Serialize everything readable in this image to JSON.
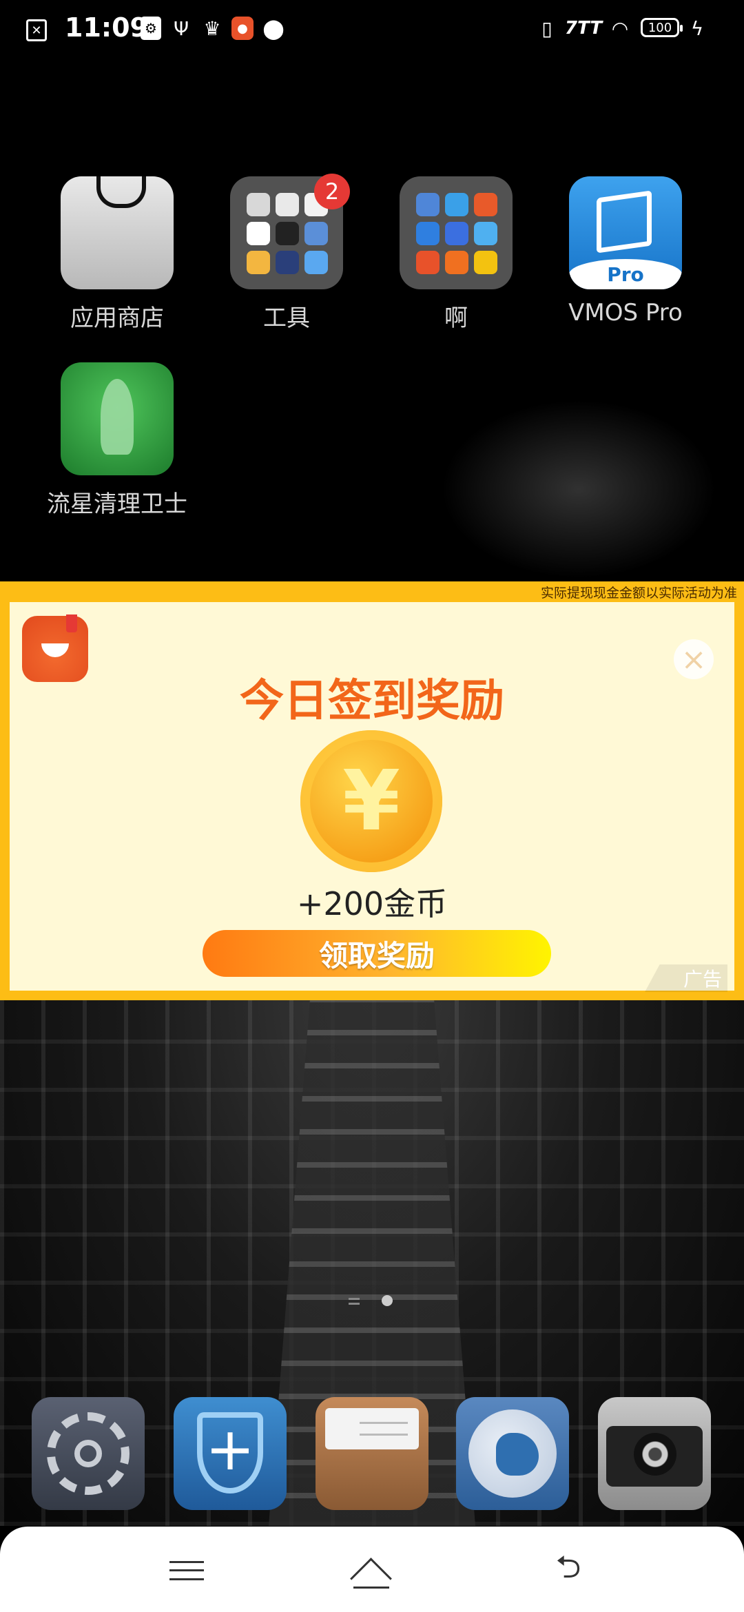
{
  "status_bar": {
    "time": "11:09",
    "battery": "100",
    "icons": [
      "sim-off-icon",
      "usb-debug-icon",
      "usb-icon",
      "crown-icon",
      "tomato-app-icon",
      "location-du-icon",
      "vibrate-icon",
      "signal-icon",
      "wifi-icon",
      "battery-icon",
      "charging-icon"
    ]
  },
  "apps": [
    {
      "label": "应用商店",
      "icon": "app-store-bag-icon"
    },
    {
      "label": "工具",
      "icon": "folder-icon",
      "badge": "2"
    },
    {
      "label": "啊",
      "icon": "folder-icon"
    },
    {
      "label": "VMOS Pro",
      "icon": "vmos-pro-icon",
      "badge_text": "Pro"
    },
    {
      "label": "流星清理卫士",
      "icon": "rocket-cleaner-icon"
    }
  ],
  "ad": {
    "disclaimer": "实际提现现金金额以实际活动为准",
    "title": "今日签到奖励",
    "coin_symbol": "¥",
    "reward": "+200金币",
    "button": "领取奖励",
    "tag": "广告",
    "close": "×"
  },
  "dock": [
    {
      "name": "settings",
      "icon": "settings-gear-icon"
    },
    {
      "name": "security",
      "icon": "security-shield-icon"
    },
    {
      "name": "files",
      "icon": "file-manager-icon"
    },
    {
      "name": "browser",
      "icon": "browser-globe-icon"
    },
    {
      "name": "camera",
      "icon": "camera-icon"
    }
  ],
  "nav": {
    "back": "⮌"
  },
  "colors": {
    "ad_border": "#fdbd15",
    "ad_background": "#fff9d6",
    "ad_title": "#f2661a",
    "badge": "#e53935"
  }
}
